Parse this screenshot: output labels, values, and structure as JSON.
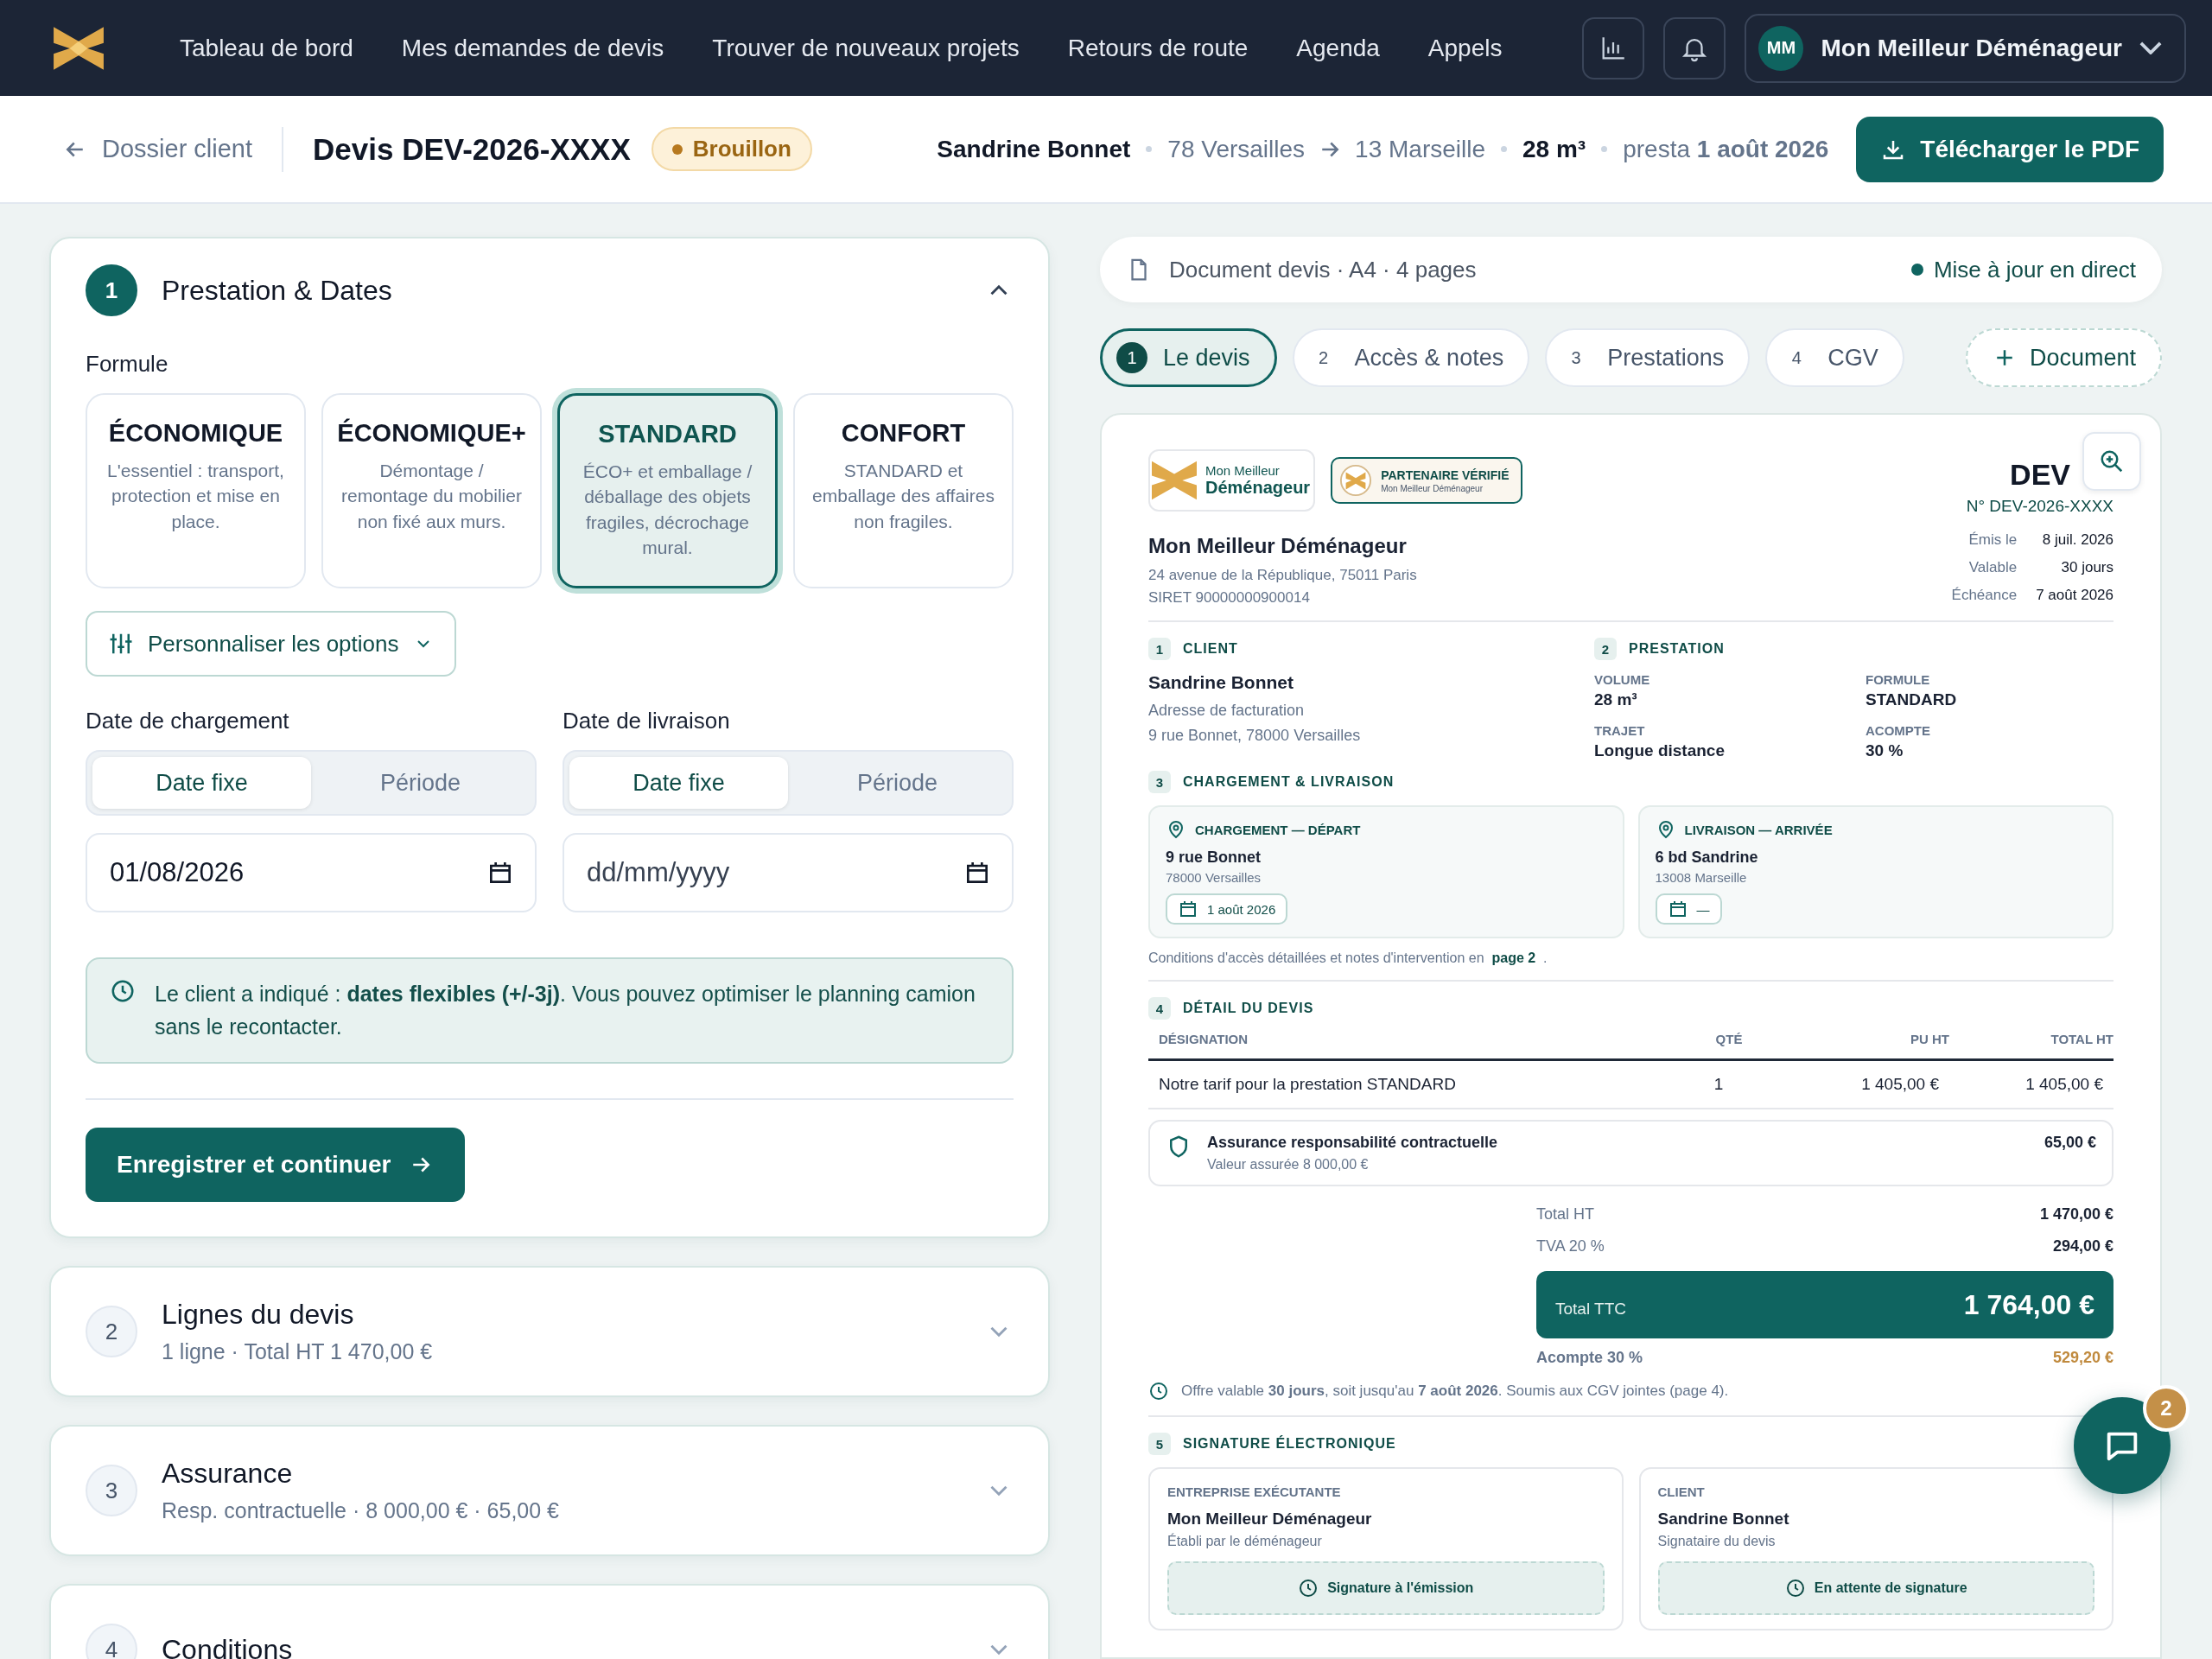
{
  "nav": {
    "items": [
      {
        "label": "Tableau de bord"
      },
      {
        "label": "Mes demandes de devis"
      },
      {
        "label": "Trouver de nouveaux projets"
      },
      {
        "label": "Retours de route"
      },
      {
        "label": "Agenda"
      },
      {
        "label": "Appels"
      }
    ],
    "user": {
      "initials": "MM",
      "name": "Mon Meilleur Déménageur"
    }
  },
  "header": {
    "back": "Dossier client",
    "title": "Devis DEV-2026-XXXX",
    "status": "Brouillon",
    "client": "Sandrine Bonnet",
    "from": "78 Versailles",
    "to": "13 Marseille",
    "volume": "28 m³",
    "date": "presta **1 août 2026**",
    "download": "Télécharger le PDF"
  },
  "sections": [
    {
      "step": "1",
      "title": "Prestation & Dates",
      "expanded": true
    },
    {
      "step": "2",
      "title": "Lignes du devis",
      "summary": "1 ligne · Total HT 1 470,00 €",
      "expanded": false
    },
    {
      "step": "3",
      "title": "Assurance",
      "summary": "Resp. contractuelle · 8 000,00 € · 65,00 €",
      "expanded": false
    },
    {
      "step": "4",
      "title": "Conditions",
      "expanded": false
    }
  ],
  "prestation": {
    "formula_label": "Formule",
    "formulas": [
      {
        "name": "ÉCONOMIQUE",
        "description": "L'essentiel : transport, protection et mise en place.",
        "selected": false
      },
      {
        "name": "ÉCONOMIQUE+",
        "description": "Démontage / remontage du mobilier non fixé aux murs.",
        "selected": false
      },
      {
        "name": "STANDARD",
        "description": "ÉCO+ et emballage / déballage des objets fragiles, décrochage mural.",
        "selected": true
      },
      {
        "name": "CONFORT",
        "description": "STANDARD et emballage des affaires non fragiles.",
        "selected": false
      }
    ],
    "customize": "Personnaliser les options",
    "dates": [
      {
        "label": "Date de chargement",
        "modes": [
          {
            "label": "Date fixe",
            "selected": true
          },
          {
            "label": "Période",
            "selected": false
          }
        ],
        "value": "01/08/2026"
      },
      {
        "label": "Date de livraison",
        "modes": [
          {
            "label": "Date fixe",
            "selected": true
          },
          {
            "label": "Période",
            "selected": false
          }
        ],
        "placeholder": "dd/mm/yyyy"
      }
    ],
    "info": "Le client a indiqué : **dates flexibles (+/-3j)**. Vous pouvez optimiser le planning camion sans le recontacter.",
    "save": "Enregistrer et continuer"
  },
  "doc_bar": {
    "title": "Document devis · A4 · 4 pages",
    "live": "Mise à jour en direct"
  },
  "doc_tabs": [
    {
      "step": "1",
      "label": "Le devis",
      "selected": true
    },
    {
      "step": "2",
      "label": "Accès & notes",
      "selected": false
    },
    {
      "step": "3",
      "label": "Prestations",
      "selected": false
    },
    {
      "step": "4",
      "label": "CGV",
      "selected": false
    }
  ],
  "add_document": "Document",
  "doc": {
    "brand": {
      "line1": "Mon Meilleur",
      "line2": "Déménageur"
    },
    "partner": {
      "title": "PARTENAIRE VÉRIFIÉ",
      "subtitle": "Mon Meilleur Déménageur"
    },
    "title": "DEV",
    "number": "N° DEV-2026-XXXX",
    "company": {
      "name": "Mon Meilleur Déménageur",
      "address": "24 avenue de la République, 75011 Paris",
      "siret": "SIRET 90000000900014"
    },
    "meta": [
      {
        "label": "Émis le",
        "value": "8 juil. 2026"
      },
      {
        "label": "Valable",
        "value": "30 jours"
      },
      {
        "label": "Échéance",
        "value": "7 août 2026"
      }
    ],
    "client": {
      "step": "1",
      "heading": "CLIENT",
      "name": "Sandrine Bonnet",
      "billing_label": "Adresse de facturation",
      "address": "9 rue Bonnet, 78000 Versailles"
    },
    "prestation": {
      "step": "2",
      "heading": "PRESTATION",
      "fields": [
        {
          "label": "VOLUME",
          "value": "28 m³"
        },
        {
          "label": "FORMULE",
          "value": "STANDARD"
        },
        {
          "label": "TRAJET",
          "value": "Longue distance"
        },
        {
          "label": "ACOMPTE",
          "value": "30 %"
        }
      ]
    },
    "logistics": {
      "step": "3",
      "heading": "CHARGEMENT & LIVRAISON",
      "stops": [
        {
          "heading": "CHARGEMENT — DÉPART",
          "street": "9 rue Bonnet",
          "city": "78000 Versailles",
          "date": "1 août 2026"
        },
        {
          "heading": "LIVRAISON — ARRIVÉE",
          "street": "6 bd Sandrine",
          "city": "13008 Marseille",
          "date": "—"
        }
      ],
      "note": "Conditions d'accès détaillées et notes d'intervention en",
      "note_link": "page 2",
      "note_end": "."
    },
    "lines": {
      "step": "4",
      "heading": "DÉTAIL DU DEVIS",
      "columns": [
        "DÉSIGNATION",
        "QTÉ",
        "PU HT",
        "TOTAL HT"
      ],
      "rows": [
        [
          "Notre tarif pour la prestation STANDARD",
          "1",
          "1 405,00 €",
          "1 405,00 €"
        ]
      ]
    },
    "insurance": {
      "title": "Assurance responsabilité contractuelle",
      "subtitle": "Valeur assurée 8 000,00 €",
      "amount": "65,00 €"
    },
    "totals": [
      {
        "label": "Total HT",
        "value": "1 470,00 €"
      },
      {
        "label": "TVA 20 %",
        "value": "294,00 €"
      }
    ],
    "ttc": {
      "label": "Total TTC",
      "value": "1 764,00 €"
    },
    "deposit": {
      "label": "Acompte 30 %",
      "value": "529,20 €"
    },
    "validity": "Offre valable **30 jours**, soit jusqu'au **7 août 2026**. Soumis aux CGV jointes (page 4).",
    "signature": {
      "step": "5",
      "heading": "SIGNATURE ÉLECTRONIQUE",
      "parties": [
        {
          "role": "ENTREPRISE EXÉCUTANTE",
          "name": "Mon Meilleur Déménageur",
          "subtitle": "Établi par le déménageur",
          "status": "Signature à l'émission"
        },
        {
          "role": "CLIENT",
          "name": "Sandrine Bonnet",
          "subtitle": "Signataire du devis",
          "status": "En attente de signature"
        }
      ]
    }
  },
  "chat": {
    "badge": "2"
  }
}
